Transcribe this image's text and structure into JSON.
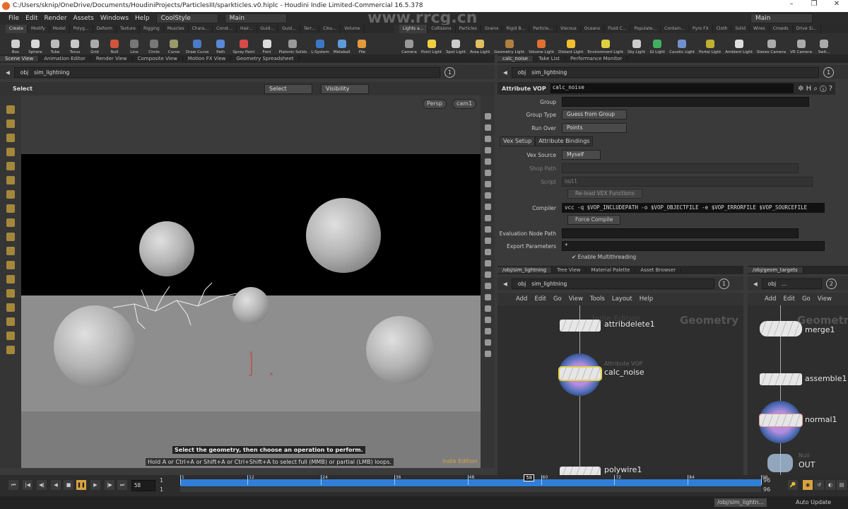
{
  "window": {
    "title": "C:/Users/sknip/OneDrive/Documents/HoudiniProjects/ParticlesIII/sparkticles.v0.hiplc - Houdini Indie Limited-Commercial 16.5.378",
    "controls": [
      "–",
      "❐",
      "✕"
    ]
  },
  "menubar": {
    "items": [
      "File",
      "Edit",
      "Render",
      "Assets",
      "Windows",
      "Help"
    ],
    "desktop": "CoolStyle",
    "desktop_right": "Main",
    "main_left": "Main"
  },
  "watermark": "www.rrcg.cn",
  "shelf_left": {
    "tabs": [
      "Create",
      "Modify",
      "Model",
      "Polyg...",
      "Deform",
      "Texture",
      "Rigging",
      "Muscles",
      "Chara...",
      "Const...",
      "Hair...",
      "Guid...",
      "Guid...",
      "Terr...",
      "Clou...",
      "Volume"
    ],
    "tools": [
      {
        "label": "Box",
        "color": "#cfcfcf"
      },
      {
        "label": "Sphere",
        "color": "#d8d8d8"
      },
      {
        "label": "Tube",
        "color": "#bbbbbb"
      },
      {
        "label": "Torus",
        "color": "#c8c8c8"
      },
      {
        "label": "Grid",
        "color": "#aaaaaa"
      },
      {
        "label": "Null",
        "color": "#d0553a"
      },
      {
        "label": "Line",
        "color": "#777777"
      },
      {
        "label": "Circle",
        "color": "#777777"
      },
      {
        "label": "Curve",
        "color": "#9a9a6a"
      },
      {
        "label": "Draw Curve",
        "color": "#4a7ac8"
      },
      {
        "label": "Path",
        "color": "#5a88d8"
      },
      {
        "label": "Spray Paint",
        "color": "#d84a4a"
      },
      {
        "label": "Font",
        "color": "#dddddd"
      },
      {
        "label": "Platonic Solids",
        "color": "#999999"
      },
      {
        "label": "L-System",
        "color": "#3c78c8"
      },
      {
        "label": "Metaball",
        "color": "#5b9bd8"
      },
      {
        "label": "File",
        "color": "#e39a3c"
      }
    ]
  },
  "shelf_right": {
    "tabs": [
      "Lights a...",
      "Collisions",
      "Particles",
      "Grains",
      "Rigid B...",
      "Particle...",
      "Viscous",
      "Oceans",
      "Fluid C...",
      "Populate...",
      "Contain...",
      "Pyro FX",
      "Cloth",
      "Solid",
      "Wires",
      "Crowds",
      "Drive Si..."
    ],
    "tools": [
      {
        "label": "Camera",
        "color": "#999999"
      },
      {
        "label": "Point Light",
        "color": "#f0d040"
      },
      {
        "label": "Spot Light",
        "color": "#cccccc"
      },
      {
        "label": "Area Light",
        "color": "#e0c060"
      },
      {
        "label": "Geometry Light",
        "color": "#b08040"
      },
      {
        "label": "Volume Light",
        "color": "#e07030"
      },
      {
        "label": "Distant Light",
        "color": "#f0c030"
      },
      {
        "label": "Environment Light",
        "color": "#e0d040"
      },
      {
        "label": "Sky Light",
        "color": "#cccccc"
      },
      {
        "label": "GI Light",
        "color": "#40b060"
      },
      {
        "label": "Caustic Light",
        "color": "#7090d0"
      },
      {
        "label": "Portal Light",
        "color": "#c0b030"
      },
      {
        "label": "Ambient Light",
        "color": "#dddddd"
      },
      {
        "label": "Stereo Camera",
        "color": "#aaaaaa"
      },
      {
        "label": "VR Camera",
        "color": "#aaaaaa"
      },
      {
        "label": "Swit...",
        "color": "#aaaaaa"
      }
    ]
  },
  "left_pane": {
    "tabs": [
      "Scene View",
      "Animation Editor",
      "Render View",
      "Composite View",
      "Motion FX View",
      "Geometry Spreadsheet"
    ],
    "path": [
      "obj",
      "sim_lightning"
    ],
    "viewport_num": "1",
    "toolbar": {
      "tool": "Select",
      "select_menu": "Select",
      "visibility_menu": "Visibility"
    },
    "view_menus": [
      "Persp",
      "cam1"
    ],
    "prompt": "Select the geometry, then choose an operation to perform.",
    "hint": "Hold A or Ctrl+A or Shift+A or Ctrl+Shift+A to select full (MMB) or partial (LMB) loops.",
    "edition": "Indie Edition",
    "axis": {
      "y": "y",
      "x": "x"
    }
  },
  "params": {
    "tabs": [
      "calc_noise",
      "Take List",
      "Performance Monitor"
    ],
    "path": [
      "obj",
      "sim_lightning"
    ],
    "num": "1",
    "node_type": "Attribute VOP",
    "node_name": "calc_noise",
    "group": {
      "label": "Group",
      "value": ""
    },
    "group_type": {
      "label": "Group Type",
      "value": "Guess from Group"
    },
    "run_over": {
      "label": "Run Over",
      "value": "Points"
    },
    "subtabs": [
      "Vex Setup",
      "Attribute Bindings"
    ],
    "vex_source": {
      "label": "Vex Source",
      "value": "Myself"
    },
    "shop_path": {
      "label": "Shop Path",
      "value": ""
    },
    "script": {
      "label": "Script",
      "value": "null"
    },
    "reload": "Re-load VEX Functions",
    "compiler": {
      "label": "Compiler",
      "value": "vcc -q $VOP_INCLUDEPATH -o $VOP_OBJECTFILE -e $VOP_ERRORFILE $VOP_SOURCEFILE"
    },
    "force_compile": "Force Compile",
    "eval_path": {
      "label": "Evaluation Node Path",
      "value": ""
    },
    "export": {
      "label": "Export Parameters",
      "value": "*"
    },
    "multithread": {
      "label": "Enable Multithreading",
      "checked": true
    }
  },
  "network": {
    "tabs": [
      "/obj/sim_lightning",
      "Tree View",
      "Material Palette",
      "Asset Browser"
    ],
    "path": [
      "obj",
      "sim_lightning"
    ],
    "num": "1",
    "menu": [
      "Add",
      "Edit",
      "Go",
      "View",
      "Tools",
      "Layout",
      "Help"
    ],
    "watermark_edition": "Indie Edition",
    "context": "Geometry",
    "nodes": [
      {
        "name": "attribdelete1",
        "type": ""
      },
      {
        "name": "calc_noise",
        "type": "Attribute VOP"
      },
      {
        "name": "polywire1",
        "type": ""
      }
    ]
  },
  "network2": {
    "tabs": [
      "/obj/geom_targets"
    ],
    "path": [
      "obj",
      "..."
    ],
    "num": "2",
    "menu": [
      "Add",
      "Edit",
      "Go",
      "View"
    ],
    "context": "Geometry",
    "nodes": [
      {
        "name": "merge1",
        "type": ""
      },
      {
        "name": "assemble1",
        "type": ""
      },
      {
        "name": "normal1",
        "type": ""
      },
      {
        "name": "OUT",
        "type": "Null"
      }
    ]
  },
  "timeline": {
    "current_frame": "58",
    "start": "1",
    "start2": "1",
    "end": "96",
    "end2": "96",
    "range": [
      1,
      96
    ],
    "ticks": [
      "1",
      "12",
      "24",
      "36",
      "48",
      "60",
      "72",
      "84",
      "96"
    ],
    "accent": "#2f7fd8",
    "playing": true
  },
  "status": {
    "path": "/obj/sim_lightn...",
    "update": "Auto Update"
  }
}
